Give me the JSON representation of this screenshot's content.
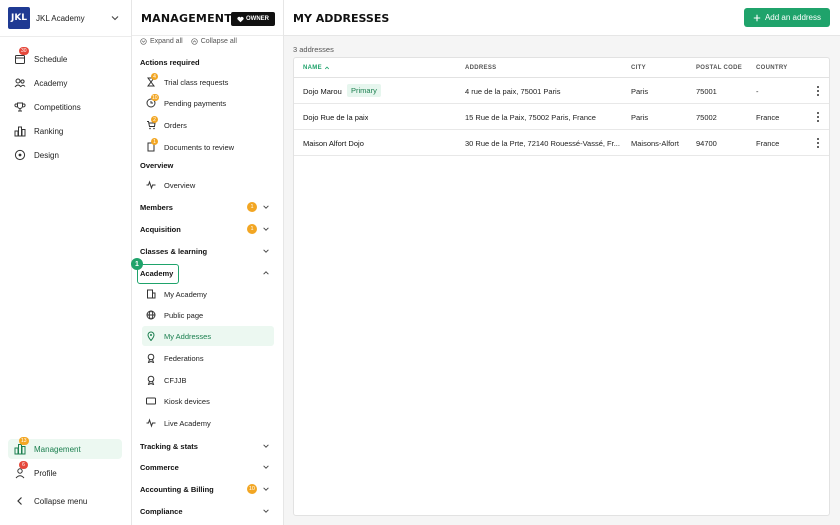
{
  "org": {
    "logo_text": "JKL",
    "name": "JKL Academy"
  },
  "left_nav": {
    "items": [
      {
        "label": "Schedule",
        "badge": "30"
      },
      {
        "label": "Academy"
      },
      {
        "label": "Competitions"
      },
      {
        "label": "Ranking"
      },
      {
        "label": "Design"
      }
    ],
    "bottom": [
      {
        "label": "Management",
        "badge": "13"
      },
      {
        "label": "Profile",
        "badge": "6"
      },
      {
        "label": "Collapse menu"
      }
    ]
  },
  "mid": {
    "title": "MANAGEMENT",
    "owner_label": "OWNER",
    "expand_all": "Expand all",
    "collapse_all": "Collapse all",
    "actions_title": "Actions required",
    "actions": [
      {
        "label": "Trial class requests",
        "badge": "4"
      },
      {
        "label": "Pending payments",
        "badge": "10"
      },
      {
        "label": "Orders",
        "badge": "2"
      },
      {
        "label": "Documents to review",
        "badge": "1"
      }
    ],
    "overview_title": "Overview",
    "overview_item": "Overview",
    "groups": [
      {
        "label": "Members",
        "count": "1"
      },
      {
        "label": "Acquisition",
        "count": "1"
      },
      {
        "label": "Classes & learning"
      },
      {
        "label": "Academy"
      }
    ],
    "academy_items": [
      {
        "label": "My Academy"
      },
      {
        "label": "Public page"
      },
      {
        "label": "My Addresses"
      },
      {
        "label": "Federations"
      },
      {
        "label": "CFJJB"
      },
      {
        "label": "Kiosk devices"
      },
      {
        "label": "Live Academy"
      }
    ],
    "groups_after": [
      {
        "label": "Tracking & stats"
      },
      {
        "label": "Commerce"
      },
      {
        "label": "Accounting & Billing",
        "count": "10"
      },
      {
        "label": "Compliance"
      }
    ],
    "step_number": "1"
  },
  "main": {
    "title": "MY ADDRESSES",
    "add_button": "Add an address",
    "count_text": "3 addresses",
    "columns": [
      "NAME",
      "ADDRESS",
      "CITY",
      "POSTAL CODE",
      "COUNTRY"
    ],
    "primary_label": "Primary",
    "rows": [
      {
        "name": "Dojo Marou",
        "primary": true,
        "address": "4 rue de la paix, 75001 Paris",
        "city": "Paris",
        "postal": "75001",
        "country": "-"
      },
      {
        "name": "Dojo Rue de la paix",
        "address": "15 Rue de la Paix, 75002 Paris, France",
        "city": "Paris",
        "postal": "75002",
        "country": "France"
      },
      {
        "name": "Maison Alfort Dojo",
        "address": "30 Rue de la Prte, 72140 Rouessé-Vassé, Fr...",
        "city": "Maisons-Alfort",
        "postal": "94700",
        "country": "France"
      }
    ]
  },
  "colors": {
    "accent": "#1fa36b",
    "badge_red": "#e5483b",
    "badge_orange": "#f2a623"
  }
}
